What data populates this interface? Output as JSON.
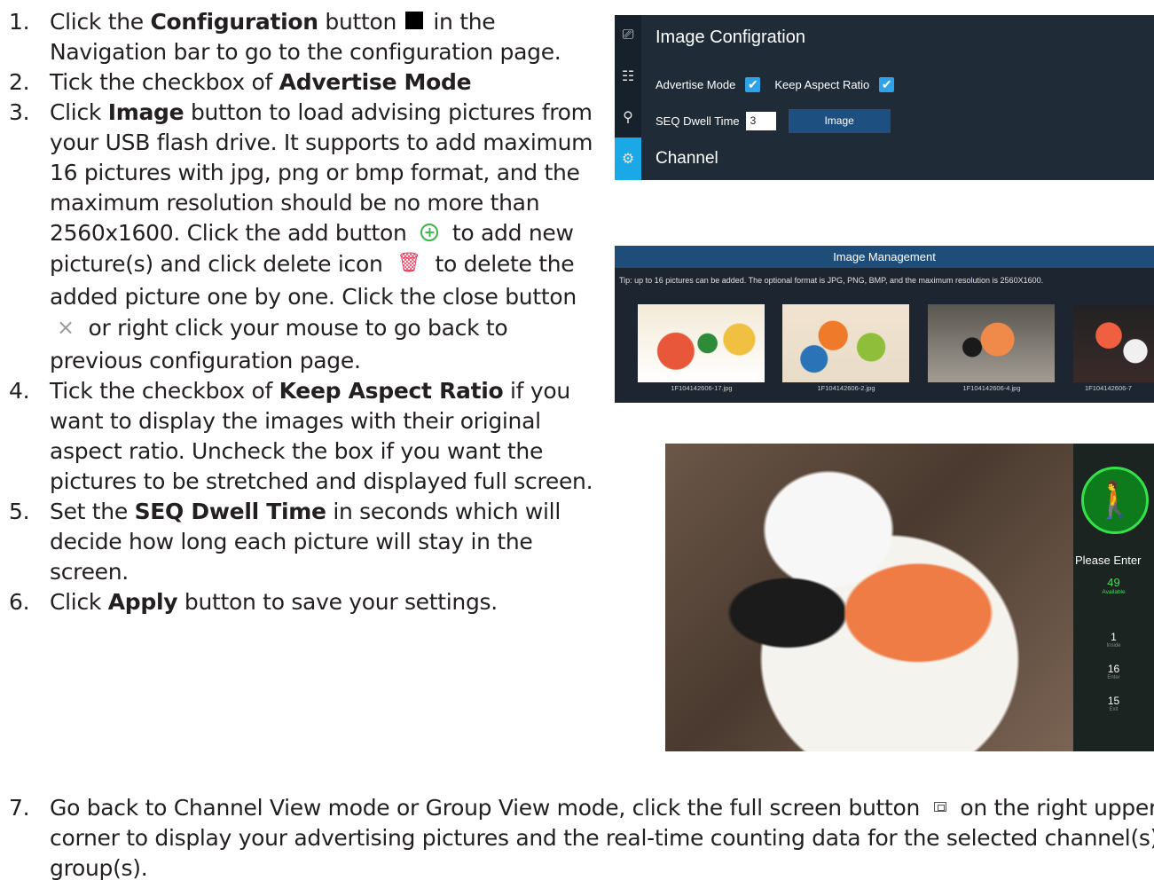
{
  "steps": [
    {
      "n": "1.",
      "a": "Click the ",
      "b": "Configuration",
      "c": " button ",
      "d": " in the Navigation bar to go to the configuration page."
    },
    {
      "n": "2.",
      "a": "Tick the checkbox of ",
      "b": "Advertise Mode"
    },
    {
      "n": "3.",
      "a": "Click ",
      "b": "Image",
      "c": " button to load advising pictures from your USB flash drive. It supports to add maximum 16 pictures with jpg, png or bmp format, and the maximum resolution should be no more than 2560x1600. Click the add button ",
      "d": " to add new picture(s) and click delete icon ",
      "e": " to delete the added picture one by one. Click the close button ",
      "f": " or right click your mouse to go back to previous configuration page."
    },
    {
      "n": "4.",
      "a": "Tick the checkbox of ",
      "b": "Keep Aspect Ratio",
      "c": " if you want to display the images with their original aspect ratio. Uncheck the box if you want the pictures to be stretched and displayed full screen."
    },
    {
      "n": "5.",
      "a": "Set the ",
      "b": "SEQ Dwell Time",
      "c": " in seconds which will decide how long each picture will stay in the screen."
    },
    {
      "n": "6.",
      "a": "Click ",
      "b": "Apply",
      "c": " button to save your settings."
    },
    {
      "n": "7.",
      "a": "Go back to Channel View mode or Group View mode, click the full screen button ",
      "b": " on the right upper corner to display your advertising pictures and the real-time counting data for the selected channel(s) or group(s)."
    }
  ],
  "icons": {
    "add": "add-circle-icon",
    "delete": "trash-icon",
    "close": "close-icon",
    "fullscreen": "fullscreen-icon",
    "config": "config-square-icon"
  },
  "config_panel": {
    "title": "Image Configration",
    "advertise_label": "Advertise Mode",
    "advertise_checked": true,
    "aspect_label": "Keep Aspect Ratio",
    "aspect_checked": true,
    "dwell_label": "SEQ Dwell Time",
    "dwell_value": "3",
    "image_button": "Image",
    "channel_label": "Channel"
  },
  "image_management": {
    "title": "Image Management",
    "tip": "Tip: up to 16 pictures can be added. The optional format is JPG, PNG, BMP, and the maximum resolution is 2560X1600.",
    "images": [
      "1F104142606-17.jpg",
      "1F104142606-2.jpg",
      "1F104142606-4.jpg",
      "1F104142606-7"
    ]
  },
  "counter_panel": {
    "prompt": "Please Enter",
    "available_value": "49",
    "available_label": "Available",
    "inside_value": "1",
    "inside_label": "Inside",
    "enter_value": "16",
    "enter_label": "Enter",
    "exit_value": "15",
    "exit_label": "Exit"
  },
  "colors": {
    "accent": "#1aa8e6",
    "panel": "#1f2c38",
    "header": "#1e4d79",
    "available": "#3be053"
  }
}
